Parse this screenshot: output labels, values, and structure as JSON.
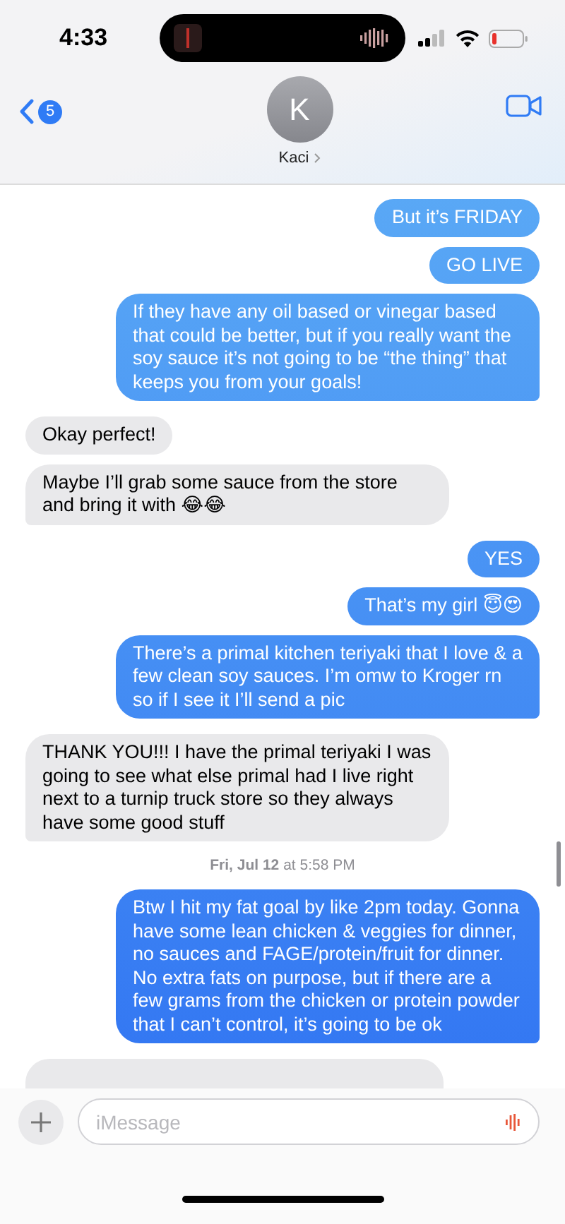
{
  "status_bar": {
    "time": "4:33"
  },
  "header": {
    "back_badge": "5",
    "avatar_initial": "K",
    "contact_name": "Kaci"
  },
  "messages": [
    {
      "kind": "sent",
      "text": "But it’s FRIDAY"
    },
    {
      "kind": "sent",
      "text": "GO LIVE"
    },
    {
      "kind": "sent",
      "text": "If they have any oil based or vinegar based that could be better, but if you really want the soy sauce it’s not going to be “the thing” that keeps you from your goals!"
    },
    {
      "kind": "received",
      "text": "Okay perfect!"
    },
    {
      "kind": "received",
      "text": "Maybe I’ll grab some sauce from the store and bring it with 😂😂"
    },
    {
      "kind": "sent",
      "text": "YES"
    },
    {
      "kind": "sent",
      "text": "That’s my girl 😇😍"
    },
    {
      "kind": "sent",
      "text": "There’s a primal kitchen teriyaki that I love & a few clean soy sauces. I’m omw to Kroger rn so if I see it I’ll send a pic"
    },
    {
      "kind": "received",
      "text": "THANK YOU!!! I have the primal teriyaki I was going to see what else primal had I live right next to a turnip truck store so they always have some good stuff"
    },
    {
      "kind": "timestamp",
      "text": "**Fri, Jul 12** at 5:58 PM"
    },
    {
      "kind": "sent",
      "text": "Btw I hit my fat goal by like 2pm today. Gonna have some lean chicken & veggies for dinner, no sauces and FAGE/protein/fruit for dinner. No extra fats on purpose, but if there are a few grams from the chicken or protein powder that I can’t control, it’s going to be ok"
    },
    {
      "kind": "partial"
    }
  ],
  "composer": {
    "placeholder": "iMessage"
  }
}
